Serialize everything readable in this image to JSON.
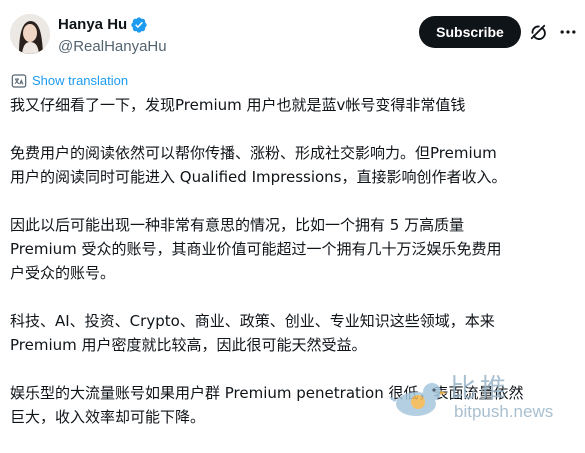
{
  "author": {
    "display_name": "Hanya Hu",
    "handle": "@RealHanyaHu"
  },
  "actions": {
    "subscribe_label": "Subscribe"
  },
  "translation": {
    "link_label": "Show translation"
  },
  "tweet": {
    "paragraphs": [
      "我又仔细看了一下，发现Premium 用户也就是蓝v帐号变得非常值钱",
      "免费用户的阅读依然可以帮你传播、涨粉、形成社交影响力。但Premium\n用户的阅读同时可能进入 Qualified Impressions，直接影响创作者收入。",
      "因此以后可能出现一种非常有意思的情况，比如一个拥有 5 万高质量\nPremium 受众的账号，其商业价值可能超过一个拥有几十万泛娱乐免费用\n户受众的账号。",
      "科技、AI、投资、Crypto、商业、政策、创业、专业知识这些领域，本来\nPremium 用户密度就比较高，因此很可能天然受益。",
      "娱乐型的大流量账号如果用户群 Premium penetration 很低，表面流量依然\n巨大，收入效率却可能下降。"
    ]
  },
  "watermark": {
    "brand_cn": "比推",
    "url": "bitpush.news"
  },
  "icons": {
    "verified": "verified-badge-icon",
    "grok": "grok-icon",
    "more": "more-icon",
    "translate": "translate-icon"
  },
  "colors": {
    "link": "#1d9bf0",
    "verified": "#1d9bf0",
    "subscribe_bg": "#0f1419",
    "secondary_text": "#536471"
  }
}
